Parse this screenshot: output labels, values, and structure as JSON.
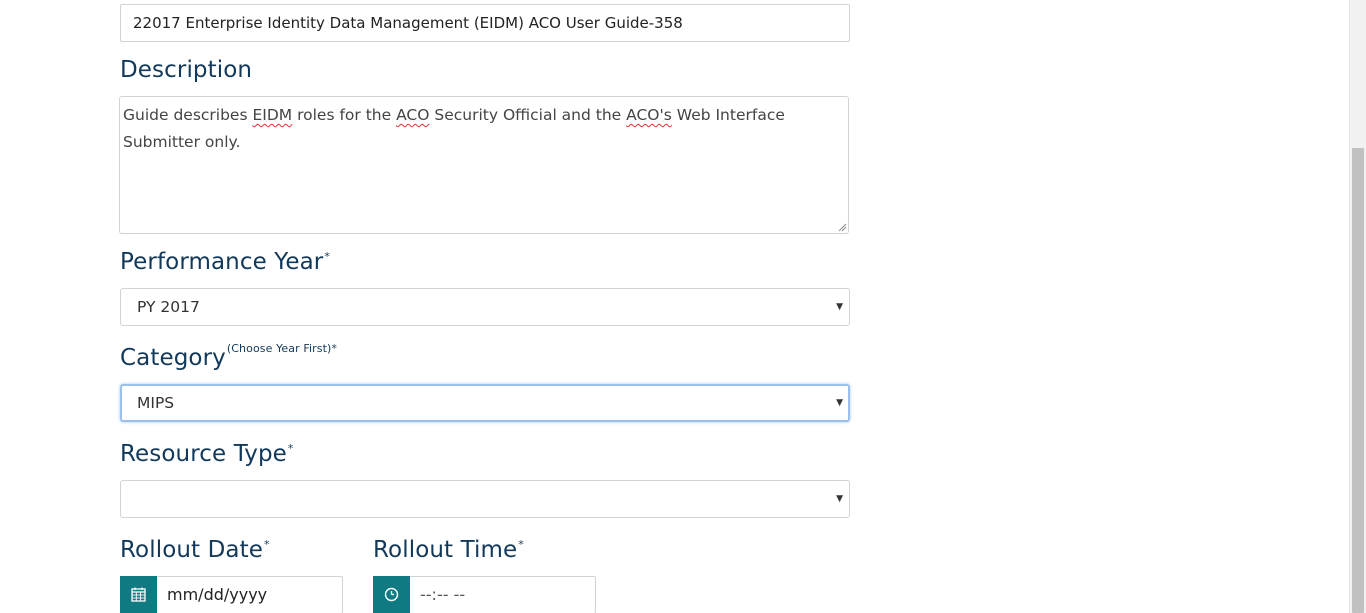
{
  "title_field": {
    "value": "22017 Enterprise Identity Data Management (EIDM) ACO User Guide-358"
  },
  "description": {
    "label": "Description",
    "parts": [
      "Guide describes ",
      "EIDM",
      " roles for the ",
      "ACO",
      " Security Official and the ",
      "ACO's",
      " Web Interface Submitter only."
    ]
  },
  "performance_year": {
    "label": "Performance Year",
    "required": "*",
    "value": "PY 2017"
  },
  "category": {
    "label": "Category",
    "hint": "(Choose Year First)*",
    "value": "MIPS"
  },
  "resource_type": {
    "label": "Resource Type",
    "required": "*",
    "value": ""
  },
  "rollout_date": {
    "label": "Rollout Date",
    "required": "*",
    "placeholder": "mm/dd/yyyy"
  },
  "rollout_time": {
    "label": "Rollout Time",
    "required": "*",
    "placeholder": "--:-- --"
  },
  "icons": {
    "date": "calendar-icon",
    "time": "clock-icon",
    "dropdown": "caret-down-icon"
  },
  "colors": {
    "label": "#12385a",
    "addon": "#107a83",
    "focus": "#9cc0ec"
  }
}
